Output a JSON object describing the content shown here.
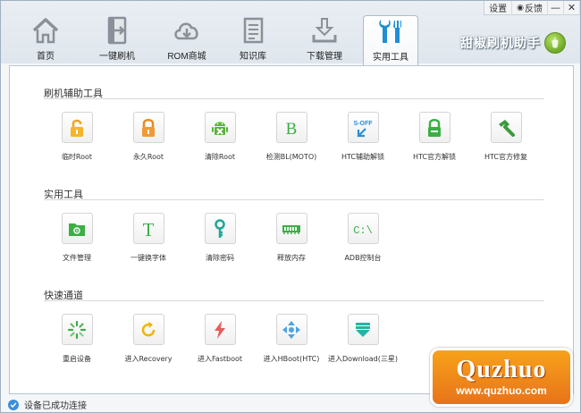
{
  "titlebar": {
    "settings": "设置",
    "feedback": "反馈",
    "minimize": "—",
    "close": "✕"
  },
  "nav": {
    "tabs": [
      {
        "label": "首页",
        "icon": "home-icon"
      },
      {
        "label": "一键刷机",
        "icon": "flash-door-icon"
      },
      {
        "label": "ROM商城",
        "icon": "cloud-download-icon"
      },
      {
        "label": "知识库",
        "icon": "document-icon"
      },
      {
        "label": "下载管理",
        "icon": "download-tray-icon"
      },
      {
        "label": "实用工具",
        "icon": "tools-icon",
        "active": true
      }
    ],
    "brand": "甜椒刷机助手"
  },
  "sections": [
    {
      "title": "刷机辅助工具",
      "items": [
        {
          "label": "临时Root",
          "icon": "lock-open-icon"
        },
        {
          "label": "永久Root",
          "icon": "lock-orange-icon"
        },
        {
          "label": "清除Root",
          "icon": "android-clear-icon"
        },
        {
          "label": "检测BL(MOTO)",
          "icon": "bootloader-b-icon"
        },
        {
          "label": "HTC辅助解锁",
          "icon": "s-off-icon"
        },
        {
          "label": "HTC官方解锁",
          "icon": "lock-green-icon"
        },
        {
          "label": "HTC官方修复",
          "icon": "hammer-icon"
        }
      ]
    },
    {
      "title": "实用工具",
      "items": [
        {
          "label": "文件管理",
          "icon": "folder-icon"
        },
        {
          "label": "一键换字体",
          "icon": "font-t-icon"
        },
        {
          "label": "清除密码",
          "icon": "key-icon"
        },
        {
          "label": "释放内存",
          "icon": "memory-icon"
        },
        {
          "label": "ADB控制台",
          "icon": "console-icon"
        }
      ]
    },
    {
      "title": "快速通道",
      "items": [
        {
          "label": "重启设备",
          "icon": "restart-spinner-icon"
        },
        {
          "label": "进入Recovery",
          "icon": "recovery-arrow-icon"
        },
        {
          "label": "进入Fastboot",
          "icon": "lightning-icon"
        },
        {
          "label": "进入HBoot(HTC)",
          "icon": "dpad-icon"
        },
        {
          "label": "进入Download(三星)",
          "icon": "download-layers-icon"
        }
      ]
    }
  ],
  "status": {
    "text": "设备已成功连接"
  },
  "watermark": {
    "big": "Quzhuo",
    "small": "www.quzhuo.com"
  },
  "colors": {
    "orange": "#f1a83b",
    "green": "#5bb13a",
    "red": "#e85b5b",
    "blue": "#3b8ed8",
    "yellow": "#f0b400"
  }
}
